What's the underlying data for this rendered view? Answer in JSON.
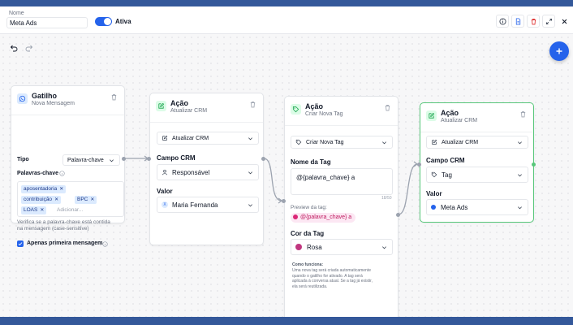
{
  "colors": {
    "primary": "#2563eb",
    "accent_green": "#58c77a",
    "tag_pink": "#c0367f",
    "header_band": "#34589a"
  },
  "header": {
    "name_label": "Nome",
    "name_value": "Meta Ads",
    "toggle_label": "Ativa",
    "toggle_on": true,
    "icons": [
      "info-icon",
      "document-icon",
      "trash-icon",
      "expand-icon",
      "close-icon"
    ]
  },
  "toolbar": {
    "icons": [
      "undo-icon",
      "redo-icon",
      "add-icon"
    ]
  },
  "nodes": {
    "trigger": {
      "title": "Gatilho",
      "subtitle": "Nova Mensagem",
      "type_label": "Tipo",
      "type_value": "Palavra-chave",
      "keywords_label": "Palavras-chave",
      "keywords": [
        "aposentadoria",
        "contribuição",
        "BPC",
        "LOAS"
      ],
      "add_placeholder": "Adicionar...",
      "hint_line1": "Verifica se a palavra-chave está contida",
      "hint_line2": "na mensagem (case-sensitive)",
      "first_message_label": "Apenas primeira mensagem",
      "first_message_checked": true
    },
    "action1": {
      "title": "Ação",
      "subtitle": "Atualizar CRM",
      "action_value": "Atualizar CRM",
      "field_label": "Campo CRM",
      "field_value": "Responsável",
      "value_label": "Valor",
      "value_value": "Maria Fernanda"
    },
    "action2": {
      "title": "Ação",
      "subtitle": "Criar Nova Tag",
      "action_value": "Criar Nova Tag",
      "tagname_label": "Nome da Tag",
      "tagname_value": "@{palavra_chave} a",
      "counter": "18/50",
      "preview_label": "Preview da tag:",
      "preview_value": "@{palavra_chave} a",
      "color_label": "Cor da Tag",
      "color_value": "Rosa",
      "how_title": "Como funciona:",
      "how_lines": [
        "Uma nova tag será criada automaticamente",
        "quando o gatilho for ativado. A tag será",
        "aplicada à conversa atual. Se a tag já existir,",
        "ela será reutilizada."
      ]
    },
    "action3": {
      "title": "Ação",
      "subtitle": "Atualizar CRM",
      "action_value": "Atualizar CRM",
      "field_label": "Campo CRM",
      "field_value": "Tag",
      "value_label": "Valor",
      "value_value": "Meta Ads"
    }
  }
}
